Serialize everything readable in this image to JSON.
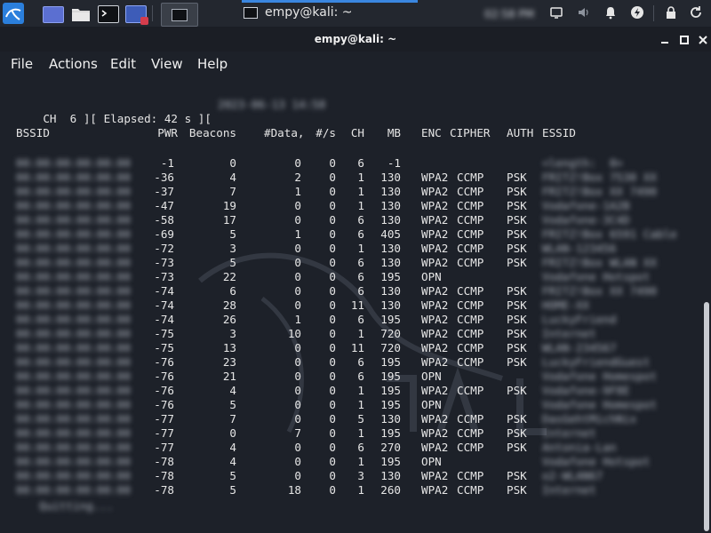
{
  "taskbar": {
    "task_title": "empy@kali: ~",
    "clock": "02:58 PM"
  },
  "window": {
    "title": "empy@kali: ~",
    "controls": [
      "minimize",
      "maximize",
      "close"
    ]
  },
  "menu": [
    "File",
    "Actions",
    "Edit",
    "View",
    "Help"
  ],
  "terminal": {
    "status_line": "CH  6 ][ Elapsed: 42 s ][",
    "status_date": "2023-06-13 14:58",
    "headers": [
      "BSSID",
      "PWR",
      "Beacons",
      "#Data,",
      "#/s",
      "CH",
      "MB",
      "ENC",
      "CIPHER",
      "AUTH",
      "ESSID"
    ],
    "rows": [
      {
        "bssid": "00:00:00:00:00:00",
        "pwr": "-1",
        "beacons": "0",
        "data": "0",
        "rate": "0",
        "ch": "6",
        "mb": "-1",
        "enc": "",
        "cipher": "",
        "auth": "",
        "essid": "<length:  0>"
      },
      {
        "bssid": "00:00:00:00:00:00",
        "pwr": "-36",
        "beacons": "4",
        "data": "2",
        "rate": "0",
        "ch": "1",
        "mb": "130",
        "enc": "WPA2",
        "cipher": "CCMP",
        "auth": "PSK",
        "essid": "FRITZ!Box 7530 XX"
      },
      {
        "bssid": "00:00:00:00:00:00",
        "pwr": "-37",
        "beacons": "7",
        "data": "1",
        "rate": "0",
        "ch": "1",
        "mb": "130",
        "enc": "WPA2",
        "cipher": "CCMP",
        "auth": "PSK",
        "essid": "FRITZ!Box XX 7490"
      },
      {
        "bssid": "00:00:00:00:00:00",
        "pwr": "-47",
        "beacons": "19",
        "data": "0",
        "rate": "0",
        "ch": "1",
        "mb": "130",
        "enc": "WPA2",
        "cipher": "CCMP",
        "auth": "PSK",
        "essid": "Vodafone-1A2B"
      },
      {
        "bssid": "00:00:00:00:00:00",
        "pwr": "-58",
        "beacons": "17",
        "data": "0",
        "rate": "0",
        "ch": "6",
        "mb": "130",
        "enc": "WPA2",
        "cipher": "CCMP",
        "auth": "PSK",
        "essid": "Vodafone-3C4D"
      },
      {
        "bssid": "00:00:00:00:00:00",
        "pwr": "-69",
        "beacons": "5",
        "data": "1",
        "rate": "0",
        "ch": "6",
        "mb": "405",
        "enc": "WPA2",
        "cipher": "CCMP",
        "auth": "PSK",
        "essid": "FRITZ!Box 6591 Cable"
      },
      {
        "bssid": "00:00:00:00:00:00",
        "pwr": "-72",
        "beacons": "3",
        "data": "0",
        "rate": "0",
        "ch": "1",
        "mb": "130",
        "enc": "WPA2",
        "cipher": "CCMP",
        "auth": "PSK",
        "essid": "WLAN-123456"
      },
      {
        "bssid": "00:00:00:00:00:00",
        "pwr": "-73",
        "beacons": "5",
        "data": "0",
        "rate": "0",
        "ch": "6",
        "mb": "130",
        "enc": "WPA2",
        "cipher": "CCMP",
        "auth": "PSK",
        "essid": "FRITZ!Box WLAN XX"
      },
      {
        "bssid": "00:00:00:00:00:00",
        "pwr": "-73",
        "beacons": "22",
        "data": "0",
        "rate": "0",
        "ch": "6",
        "mb": "195",
        "enc": "OPN",
        "cipher": "",
        "auth": "",
        "essid": "Vodafone Hotspot"
      },
      {
        "bssid": "00:00:00:00:00:00",
        "pwr": "-74",
        "beacons": "6",
        "data": "0",
        "rate": "0",
        "ch": "6",
        "mb": "130",
        "enc": "WPA2",
        "cipher": "CCMP",
        "auth": "PSK",
        "essid": "FRITZ!Box XX 7490"
      },
      {
        "bssid": "00:00:00:00:00:00",
        "pwr": "-74",
        "beacons": "28",
        "data": "0",
        "rate": "0",
        "ch": "11",
        "mb": "130",
        "enc": "WPA2",
        "cipher": "CCMP",
        "auth": "PSK",
        "essid": "HOME-XX"
      },
      {
        "bssid": "00:00:00:00:00:00",
        "pwr": "-74",
        "beacons": "26",
        "data": "1",
        "rate": "0",
        "ch": "6",
        "mb": "195",
        "enc": "WPA2",
        "cipher": "CCMP",
        "auth": "PSK",
        "essid": "LuckyFriend"
      },
      {
        "bssid": "00:00:00:00:00:00",
        "pwr": "-75",
        "beacons": "3",
        "data": "10",
        "rate": "0",
        "ch": "1",
        "mb": "720",
        "enc": "WPA2",
        "cipher": "CCMP",
        "auth": "PSK",
        "essid": "Internet"
      },
      {
        "bssid": "00:00:00:00:00:00",
        "pwr": "-75",
        "beacons": "13",
        "data": "0",
        "rate": "0",
        "ch": "11",
        "mb": "720",
        "enc": "WPA2",
        "cipher": "CCMP",
        "auth": "PSK",
        "essid": "WLAN-234567"
      },
      {
        "bssid": "00:00:00:00:00:00",
        "pwr": "-76",
        "beacons": "23",
        "data": "0",
        "rate": "0",
        "ch": "6",
        "mb": "195",
        "enc": "WPA2",
        "cipher": "CCMP",
        "auth": "PSK",
        "essid": "LuckyFriendGuest"
      },
      {
        "bssid": "00:00:00:00:00:00",
        "pwr": "-76",
        "beacons": "21",
        "data": "0",
        "rate": "0",
        "ch": "6",
        "mb": "195",
        "enc": "OPN",
        "cipher": "",
        "auth": "",
        "essid": "Vodafone Homespot"
      },
      {
        "bssid": "00:00:00:00:00:00",
        "pwr": "-76",
        "beacons": "4",
        "data": "0",
        "rate": "0",
        "ch": "1",
        "mb": "195",
        "enc": "WPA2",
        "cipher": "CCMP",
        "auth": "PSK",
        "essid": "Vodafone-9F8E"
      },
      {
        "bssid": "00:00:00:00:00:00",
        "pwr": "-76",
        "beacons": "5",
        "data": "0",
        "rate": "0",
        "ch": "1",
        "mb": "195",
        "enc": "OPN",
        "cipher": "",
        "auth": "",
        "essid": "Vodafone Homespot"
      },
      {
        "bssid": "00:00:00:00:00:00",
        "pwr": "-77",
        "beacons": "7",
        "data": "0",
        "rate": "0",
        "ch": "5",
        "mb": "130",
        "enc": "WPA2",
        "cipher": "CCMP",
        "auth": "PSK",
        "essid": "DasGehtMichNix"
      },
      {
        "bssid": "00:00:00:00:00:00",
        "pwr": "-77",
        "beacons": "0",
        "data": "7",
        "rate": "0",
        "ch": "1",
        "mb": "195",
        "enc": "WPA2",
        "cipher": "CCMP",
        "auth": "PSK",
        "essid": "Internet"
      },
      {
        "bssid": "00:00:00:00:00:00",
        "pwr": "-77",
        "beacons": "4",
        "data": "0",
        "rate": "0",
        "ch": "6",
        "mb": "270",
        "enc": "WPA2",
        "cipher": "CCMP",
        "auth": "PSK",
        "essid": "Antonia-Lan"
      },
      {
        "bssid": "00:00:00:00:00:00",
        "pwr": "-78",
        "beacons": "4",
        "data": "0",
        "rate": "0",
        "ch": "1",
        "mb": "195",
        "enc": "OPN",
        "cipher": "",
        "auth": "",
        "essid": "Vodafone Hotspot"
      },
      {
        "bssid": "00:00:00:00:00:00",
        "pwr": "-78",
        "beacons": "5",
        "data": "0",
        "rate": "0",
        "ch": "3",
        "mb": "130",
        "enc": "WPA2",
        "cipher": "CCMP",
        "auth": "PSK",
        "essid": "o2-WLAN67"
      },
      {
        "bssid": "00:00:00:00:00:00",
        "pwr": "-78",
        "beacons": "5",
        "data": "18",
        "rate": "0",
        "ch": "1",
        "mb": "260",
        "enc": "WPA2",
        "cipher": "CCMP",
        "auth": "PSK",
        "essid": "Internet"
      }
    ],
    "footer": "Quitting..."
  }
}
